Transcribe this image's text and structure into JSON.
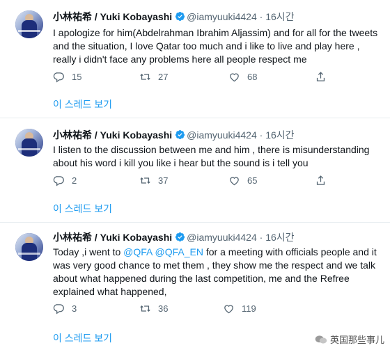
{
  "tweets": [
    {
      "name": "小林祐希 / Yuki Kobayashi",
      "handle": "@iamyuuki4424",
      "time": "16시간",
      "text": "I apologize for him(Abdelrahman Ibrahim Aljassim) and for all for the tweets and the situation, I love Qatar too much and i like to live and play here , really i didn't face any problems here all people respect me",
      "replies": "15",
      "retweets": "27",
      "likes": "68",
      "thread": "이 스레드 보기"
    },
    {
      "name": "小林祐希 / Yuki Kobayashi",
      "handle": "@iamyuuki4424",
      "time": "16시간",
      "text": "I listen to the discussion between me and him , there is misunderstanding about his word i kill you like i hear but the sound is i tell you",
      "replies": "2",
      "retweets": "37",
      "likes": "65",
      "thread": "이 스레드 보기"
    },
    {
      "name": "小林祐希 / Yuki Kobayashi",
      "handle": "@iamyuuki4424",
      "time": "16시간",
      "text_pre": "Today ,i went to ",
      "mention1": "@QFA",
      "mention2": "@QFA_EN",
      "text_post": " for a meeting with officials people and it was very good chance to met them , they show me the respect and we talk about what happened during the last competition, me and the Refree explained what happened,",
      "replies": "3",
      "retweets": "36",
      "likes": "119",
      "thread": "이 스레드 보기"
    }
  ],
  "separator": " · ",
  "watermark": "英国那些事儿",
  "colors": {
    "link": "#1d9bf0",
    "muted": "#536471",
    "verified": "#1d9bf0"
  }
}
